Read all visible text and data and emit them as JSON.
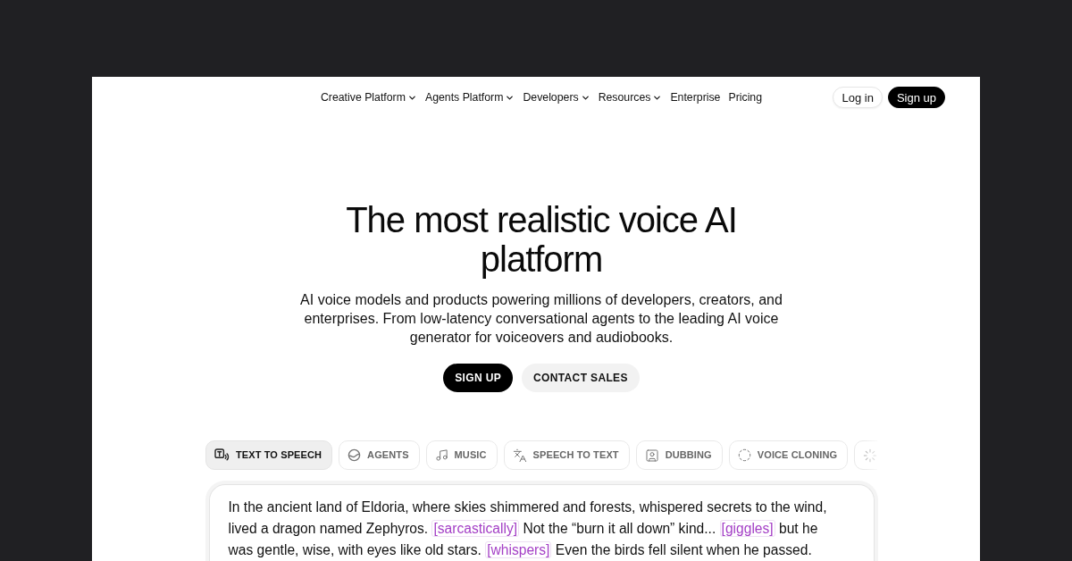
{
  "nav": {
    "links": [
      {
        "label": "Creative Platform",
        "kind": "dropdown"
      },
      {
        "label": "Agents Platform",
        "kind": "dropdown"
      },
      {
        "label": "Developers",
        "kind": "dropdown"
      },
      {
        "label": "Resources",
        "kind": "dropdown"
      },
      {
        "label": "Enterprise",
        "kind": "link"
      },
      {
        "label": "Pricing",
        "kind": "link"
      }
    ],
    "buttons": [
      {
        "label": "Log in",
        "kind": "secondary"
      },
      {
        "label": "Sign up",
        "kind": "primary"
      }
    ]
  },
  "hero": {
    "title": "The most realistic voice AI platform",
    "subtitle": "AI voice models and products powering millions of developers, creators, and enterprises. From low-latency conversational agents to the leading AI voice generator for voiceovers and audiobooks.",
    "buttons": [
      {
        "label": "SIGN UP",
        "kind": "primary"
      },
      {
        "label": "CONTACT SALES",
        "kind": "secondary"
      }
    ]
  },
  "tabs": [
    {
      "label": "TEXT TO SPEECH",
      "kind": "tts",
      "selected": true
    },
    {
      "label": "AGENTS",
      "kind": "agents",
      "selected": false
    },
    {
      "label": "MUSIC",
      "kind": "music",
      "selected": false
    },
    {
      "label": "SPEECH TO TEXT",
      "kind": "stt",
      "selected": false
    },
    {
      "label": "DUBBING",
      "kind": "dubbing",
      "selected": false
    },
    {
      "label": "VOICE CLONING",
      "kind": "cloning",
      "selected": false
    },
    {
      "kind": "spinner",
      "selected": false
    }
  ],
  "editor": {
    "segments": [
      {
        "kind": "text",
        "text": "In the ancient land of Eldoria, where skies shimmered and forests, whispered secrets to the wind, lived a dragon named Zephyros. "
      },
      {
        "kind": "tag",
        "text": "[sarcastically]"
      },
      {
        "kind": "text",
        "text": " Not the “burn it all down” kind... "
      },
      {
        "kind": "tag",
        "text": "[giggles]"
      },
      {
        "kind": "text",
        "text": " but he was gentle, wise, with eyes like old stars. "
      },
      {
        "kind": "tag",
        "text": "[whispers]"
      },
      {
        "kind": "text",
        "text": " Even the birds fell silent when he passed."
      }
    ]
  }
}
